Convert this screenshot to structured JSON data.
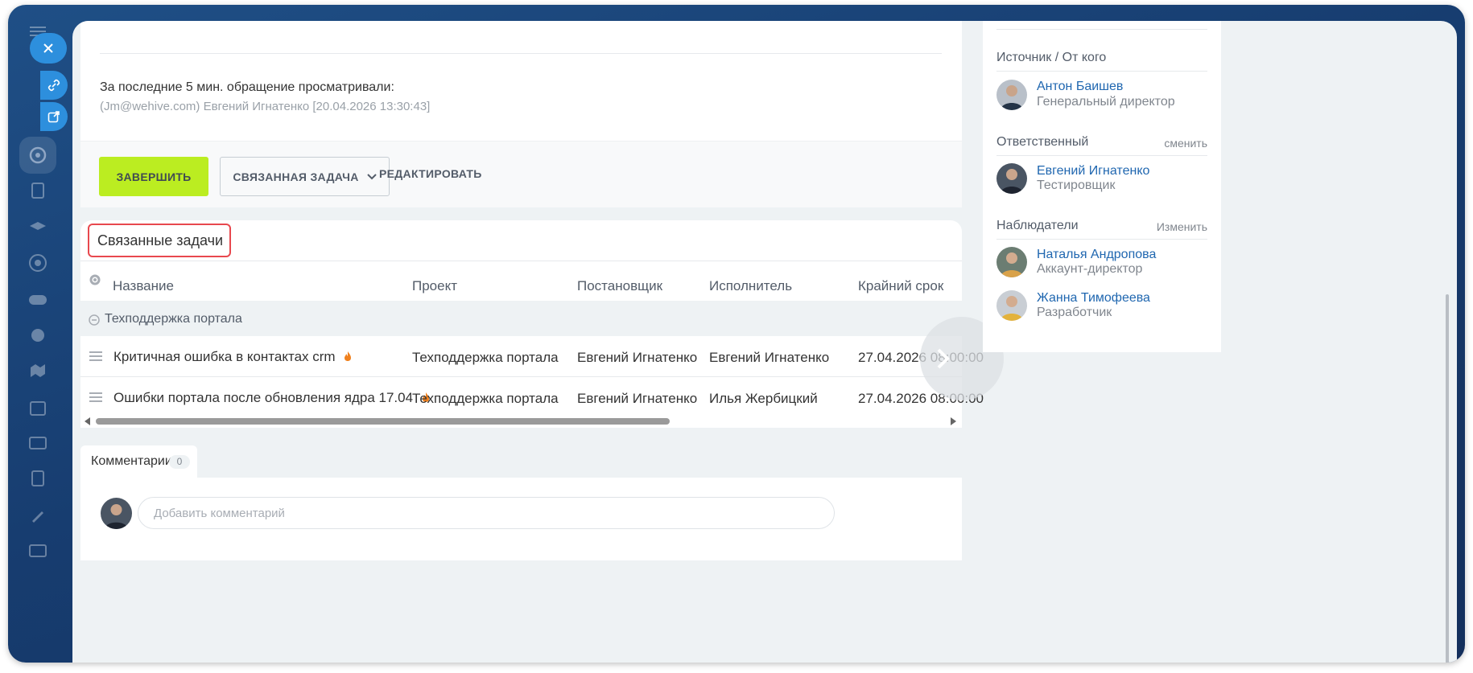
{
  "view_info": {
    "header": "За последние 5 мин. обращение просматривали:",
    "viewer": "(Jm@wehive.com) Евгений Игнатенко [20.04.2026 13:30:43]"
  },
  "actions": {
    "complete": "ЗАВЕРШИТЬ",
    "related_task": "СВЯЗАННАЯ ЗАДАЧА",
    "edit": "РЕДАКТИРОВАТЬ"
  },
  "related": {
    "title": "Связанные задачи",
    "columns": [
      "Название",
      "Проект",
      "Постановщик",
      "Исполнитель",
      "Крайний срок"
    ],
    "group": "Техподдержка портала",
    "rows": [
      {
        "name": "Критичная ошибка в контактах crm",
        "project": "Техподдержка портала",
        "creator": "Евгений Игнатенко",
        "assignee": "Евгений Игнатенко",
        "deadline": "27.04.2026 08:00:00"
      },
      {
        "name": "Ошибки портала после обновления ядра 17.04",
        "project": "Техподдержка портала",
        "creator": "Евгений Игнатенко",
        "assignee": "Илья Жербицкий",
        "deadline": "27.04.2026 08:00:00"
      }
    ]
  },
  "comments": {
    "tab_label": "Комментарии",
    "count": "0",
    "placeholder": "Добавить комментарий"
  },
  "right_panel": {
    "source": {
      "title": "Источник / От кого",
      "name": "Антон Баишев",
      "role": "Генеральный директор"
    },
    "responsible": {
      "title": "Ответственный",
      "action": "сменить",
      "name": "Евгений Игнатенко",
      "role": "Тестировщик"
    },
    "observers": {
      "title": "Наблюдатели",
      "action": "Изменить",
      "people": [
        {
          "name": "Наталья Андропова",
          "role": "Аккаунт-директор"
        },
        {
          "name": "Жанна Тимофеева",
          "role": "Разработчик"
        }
      ]
    }
  },
  "colors": {
    "accent_green": "#bbed21",
    "link_blue": "#2067b0",
    "highlight_red": "#e8484e",
    "sidebar_blue": "#173d70"
  }
}
